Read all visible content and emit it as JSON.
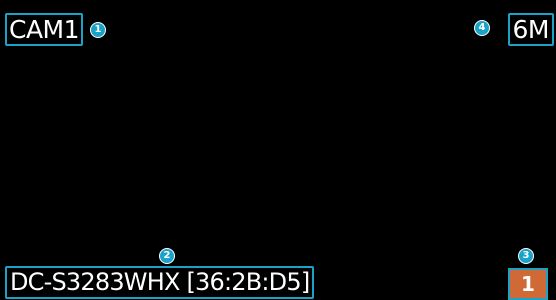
{
  "overlay": {
    "camera_label": "CAM1",
    "resolution_label": "6M",
    "device_label": "DC-S3283WHX [36:2B:D5]",
    "channel_number": "1"
  },
  "callouts": [
    "1",
    "2",
    "3",
    "4"
  ],
  "colors": {
    "background": "#000000",
    "callout_accent": "#1aa3c9",
    "channel_box": "#cf6a37",
    "text": "#ffffff"
  }
}
